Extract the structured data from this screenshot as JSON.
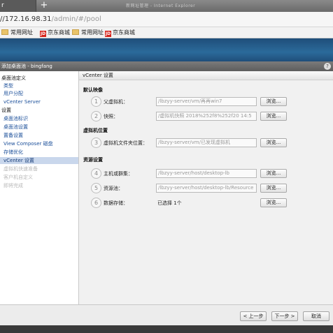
{
  "browser": {
    "tab_label": "r",
    "new_tab_label": "+",
    "window_title": "新网址管理 - Internet Explorer",
    "url_prefix": "//172.16.98.31",
    "url_path": "/admin/#/pool"
  },
  "bookmarks": [
    {
      "label": "常用网址",
      "icon": "folder-icon"
    },
    {
      "label": "京东商城",
      "icon": "jd-icon"
    },
    {
      "label": "常用网址",
      "icon": "folder-icon"
    },
    {
      "label": "京东商城",
      "icon": "jd-icon"
    }
  ],
  "dialog": {
    "title": "添加桌面池 - bingfang",
    "help_label": "?"
  },
  "sidebar": {
    "sections": [
      {
        "label": "桌面池定义"
      },
      {
        "label": "设置"
      }
    ],
    "items": [
      {
        "label": "类型",
        "state": "normal"
      },
      {
        "label": "用户分配",
        "state": "normal"
      },
      {
        "label": "vCenter Server",
        "state": "normal"
      },
      {
        "label": "桌面池标识",
        "state": "normal"
      },
      {
        "label": "桌面池设置",
        "state": "normal"
      },
      {
        "label": "置备设置",
        "state": "normal"
      },
      {
        "label": "View Composer 磁盘",
        "state": "normal"
      },
      {
        "label": "存储优化",
        "state": "normal"
      },
      {
        "label": "vCenter 设置",
        "state": "active"
      },
      {
        "label": "虚拟机快速准备",
        "state": "disabled"
      },
      {
        "label": "客户机自定义",
        "state": "disabled"
      },
      {
        "label": "即将完成",
        "state": "disabled"
      }
    ]
  },
  "main": {
    "header": "vCenter 设置",
    "sections": [
      {
        "label": "默认映像"
      },
      {
        "label": "虚拟机位置"
      },
      {
        "label": "资源设置"
      }
    ],
    "rows": [
      {
        "num": "1",
        "label": "父虚拟机：",
        "value": "/lbzyy-server/vm/再再win7",
        "browse": "浏览..."
      },
      {
        "num": "2",
        "label": "快照：",
        "value": "/虚拟机快照 2018%252f8%252f20 14:5",
        "browse": "浏览..."
      },
      {
        "num": "3",
        "label": "虚拟机文件夹位置：",
        "value": "/lbzyy-server/vm/已发现虚拟机",
        "browse": "浏览..."
      },
      {
        "num": "4",
        "label": "主机或群集：",
        "value": "/lbzyy-server/host/desktop-lb",
        "browse": "浏览..."
      },
      {
        "num": "5",
        "label": "资源池：",
        "value": "/lbzyy-server/host/desktop-lb/Resource",
        "browse": "浏览..."
      },
      {
        "num": "6",
        "label": "数据存储：",
        "value": "已选择 1个",
        "browse": "浏览..."
      }
    ]
  },
  "footer": {
    "back_label": "< 上一步",
    "next_label": "下一步 >",
    "cancel_label": "取消"
  }
}
